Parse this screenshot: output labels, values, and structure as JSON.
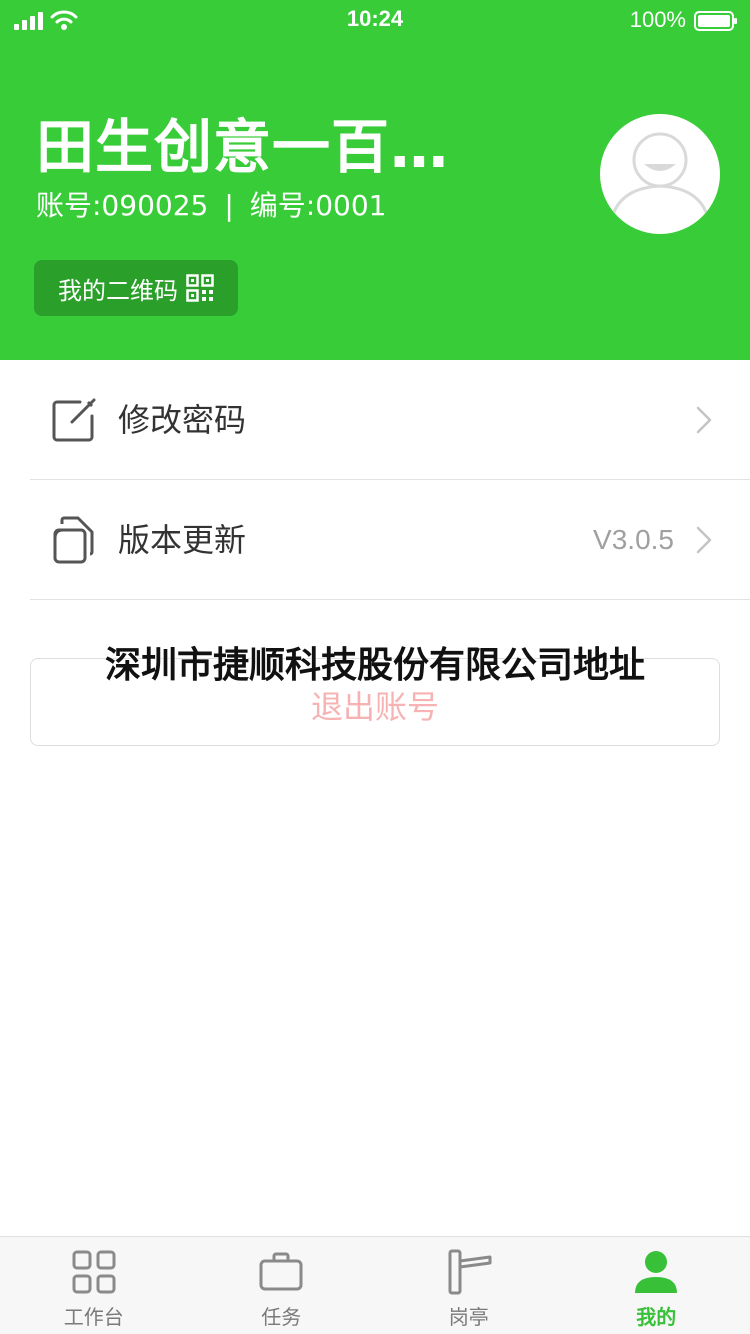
{
  "status_bar": {
    "time": "10:24",
    "battery": "100%"
  },
  "profile": {
    "name": "田生创意一百年…",
    "account_label": "账号:090025",
    "divider": "|",
    "number_label": "编号:0001",
    "qr_button_label": "我的二维码"
  },
  "menu": {
    "items": [
      {
        "label": "修改密码",
        "icon": "edit-icon",
        "value": ""
      },
      {
        "label": "版本更新",
        "icon": "copy-icon",
        "value": "V3.0.5"
      }
    ]
  },
  "logout": {
    "label": "退出账号"
  },
  "overlay": {
    "text": "深圳市捷顺科技股份有限公司地址"
  },
  "tabs": [
    {
      "label": "工作台",
      "icon": "grid-icon",
      "active": false
    },
    {
      "label": "任务",
      "icon": "briefcase-icon",
      "active": false
    },
    {
      "label": "岗亭",
      "icon": "barrier-gate-icon",
      "active": false
    },
    {
      "label": "我的",
      "icon": "person-icon",
      "active": true
    }
  ],
  "colors": {
    "brand_green": "#38cd38",
    "qr_button_bg": "#2a9f2a",
    "logout_text": "#f7b3b3",
    "active_tab": "#38c138"
  }
}
